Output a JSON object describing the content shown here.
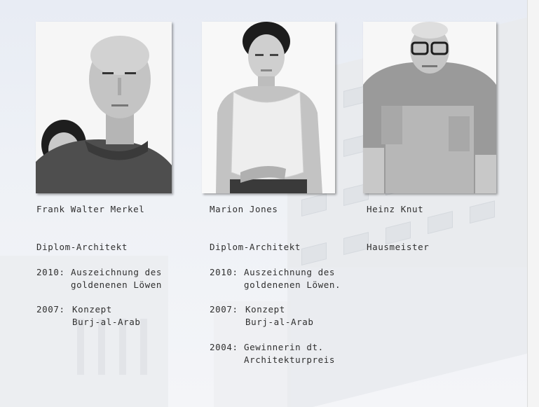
{
  "team": [
    {
      "name": "Frank Walter Merkel",
      "title": "Diplom-Architekt",
      "awards": [
        {
          "year": "2010:",
          "line1": "Auszeichnung des",
          "line2": "goldenenen Löwen"
        },
        {
          "year": "2007:",
          "line1": "Konzept",
          "line2": "Burj-al-Arab"
        }
      ]
    },
    {
      "name": "Marion Jones",
      "title": "Diplom-Architekt",
      "awards": [
        {
          "year": "2010:",
          "line1": "Auszeichnung des",
          "line2": "goldenenen Löwen."
        },
        {
          "year": "2007:",
          "line1": "Konzept",
          "line2": "Burj-al-Arab"
        },
        {
          "year": "2004:",
          "line1": "Gewinnerin dt.",
          "line2": "Architekturpreis"
        }
      ]
    },
    {
      "name": "Heinz Knut",
      "title": "Hausmeister",
      "awards": []
    }
  ]
}
